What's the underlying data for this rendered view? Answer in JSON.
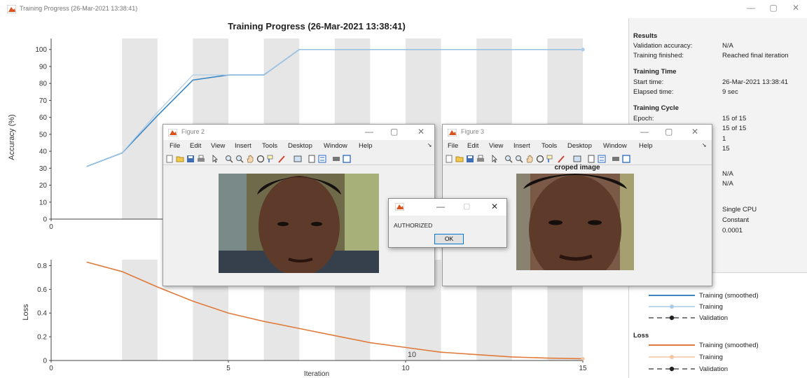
{
  "window": {
    "title": "Training Progress (26-Mar-2021 13:38:41)",
    "controls": [
      "—",
      "▢",
      "✕"
    ]
  },
  "plot": {
    "title": "Training Progress (26-Mar-2021 13:38:41)",
    "accuracy_ylabel": "Accuracy (%)",
    "loss_ylabel": "Loss",
    "xlabel": "Iteration",
    "accuracy_yticks": [
      "0",
      "10",
      "20",
      "30",
      "40",
      "50",
      "60",
      "70",
      "80",
      "90",
      "100"
    ],
    "accuracy_xtick": "0",
    "loss_yticks": [
      "0",
      "0.2",
      "0.4",
      "0.6",
      "0.8"
    ],
    "loss_xticks": [
      "0",
      "5",
      "10",
      "15"
    ],
    "loss_annotation": "10"
  },
  "chart_data": [
    {
      "type": "line",
      "title": "Training Progress (26-Mar-2021 13:38:41)",
      "ylabel": "Accuracy (%)",
      "xlim": [
        0,
        15
      ],
      "ylim": [
        0,
        100
      ],
      "x": [
        1,
        2,
        3,
        4,
        5,
        6,
        7,
        8,
        9,
        10,
        11,
        12,
        13,
        14,
        15
      ],
      "series": [
        {
          "name": "Training (smoothed)",
          "values": [
            31,
            39,
            61,
            82,
            85,
            85,
            100,
            100,
            100,
            100,
            100,
            100,
            100,
            100,
            100
          ]
        },
        {
          "name": "Training",
          "values": [
            31,
            39,
            63,
            85,
            85,
            85,
            100,
            100,
            100,
            100,
            100,
            100,
            100,
            100,
            100
          ]
        }
      ],
      "grid": "alternating epoch bands"
    },
    {
      "type": "line",
      "xlabel": "Iteration",
      "ylabel": "Loss",
      "xlim": [
        0,
        15
      ],
      "ylim": [
        0,
        0.85
      ],
      "x": [
        1,
        2,
        3,
        4,
        5,
        6,
        7,
        8,
        9,
        10,
        11,
        12,
        13,
        14,
        15
      ],
      "series": [
        {
          "name": "Training (smoothed)",
          "values": [
            0.83,
            0.75,
            0.62,
            0.5,
            0.4,
            0.33,
            0.27,
            0.21,
            0.15,
            0.11,
            0.07,
            0.05,
            0.03,
            0.02,
            0.015
          ]
        }
      ]
    }
  ],
  "results": {
    "heading": "Results",
    "rows": [
      {
        "k": "Validation accuracy:",
        "v": "N/A"
      },
      {
        "k": "Training finished:",
        "v": "Reached final iteration"
      }
    ]
  },
  "training_time": {
    "heading": "Training Time",
    "rows": [
      {
        "k": "Start time:",
        "v": "26-Mar-2021 13:38:41"
      },
      {
        "k": "Elapsed time:",
        "v": "9 sec"
      }
    ]
  },
  "training_cycle": {
    "heading": "Training Cycle",
    "rows": [
      {
        "k": "Epoch:",
        "v": "15 of 15"
      }
    ],
    "extra_values": [
      "15 of 15",
      "1",
      "15"
    ]
  },
  "partial_values": [
    "N/A",
    "N/A",
    "Single CPU",
    "Constant",
    "0.0001"
  ],
  "legend": {
    "accuracy": [
      "Training (smoothed)",
      "Training",
      "Validation"
    ],
    "loss_heading": "Loss",
    "loss": [
      "Training (smoothed)",
      "Training",
      "Validation"
    ]
  },
  "figure2": {
    "title": "Figure 2",
    "menu": [
      "File",
      "Edit",
      "View",
      "Insert",
      "Tools",
      "Desktop",
      "Window",
      "Help"
    ]
  },
  "figure3": {
    "title": "Figure 3",
    "menu": [
      "File",
      "Edit",
      "View",
      "Insert",
      "Tools",
      "Desktop",
      "Window",
      "Help"
    ],
    "image_title": "croped image"
  },
  "dialog": {
    "message": "AUTHORIZED",
    "ok_label": "OK"
  },
  "colors": {
    "accuracy": "#3a87c3",
    "accuracy_raw": "#aacbe6",
    "loss": "#e07a3a",
    "loss_raw": "#f3c6a6",
    "band": "#e6e6e6"
  }
}
